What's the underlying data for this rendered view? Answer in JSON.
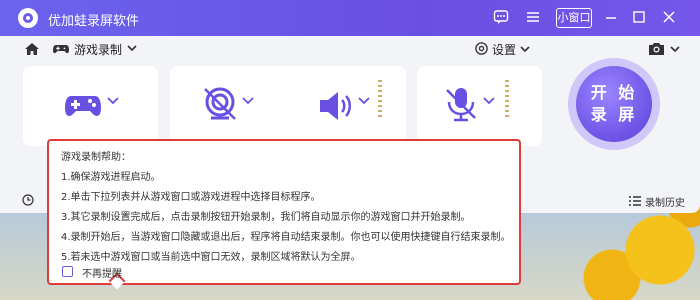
{
  "app": {
    "title": "优加蛙录屏软件",
    "mini_window_label": "小窗口",
    "icons": [
      "message-icon",
      "menu-icon",
      "minimize-icon",
      "maximize-icon",
      "close-icon"
    ]
  },
  "toolbar": {
    "mode_label": "游戏录制",
    "settings_label": "设置",
    "history_label": "录制历史"
  },
  "record_button": {
    "line1": "开 始",
    "line2": "录 屏"
  },
  "help_popup": {
    "title": "游戏录制帮助：",
    "lines": [
      "1.确保游戏进程启动。",
      "2.单击下拉列表并从游戏窗口或游戏进程中选择目标程序。",
      "3.其它录制设置完成后，点击录制按钮开始录制，我们将自动显示你的游戏窗口并开始录制。",
      "4.录制开始后，当游戏窗口隐藏或退出后，程序将自动结束录制。你也可以使用快捷键自行结束录制。",
      "5.若未选中游戏窗口或当前选中窗口无效，录制区域将默认为全屏。"
    ],
    "checkbox_label": "不再提醒",
    "checkbox_checked": false
  },
  "colors": {
    "accent": "#6b5ce9",
    "popup_border": "#e03a3a",
    "titlebar": "#6a4fe3"
  }
}
